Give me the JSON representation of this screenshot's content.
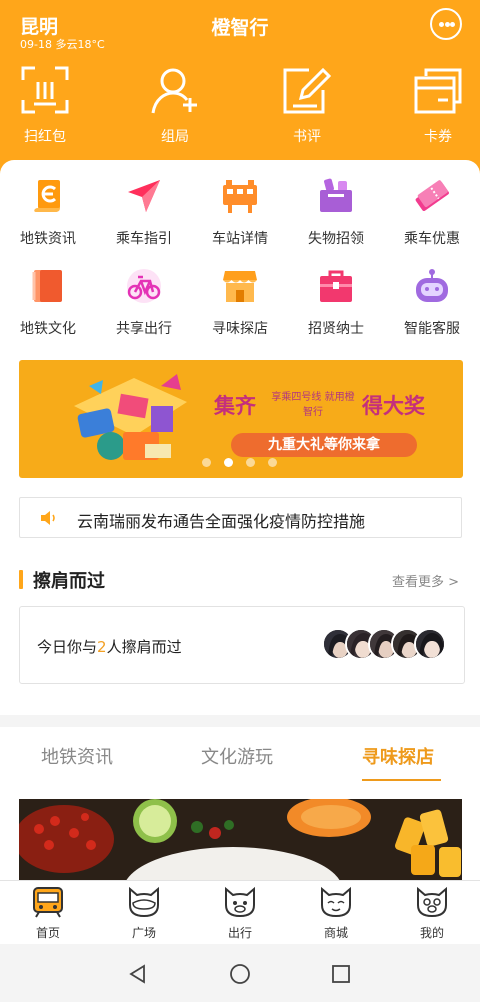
{
  "status": {
    "city": "昆明",
    "weather": "09-18 多云18°C"
  },
  "header": {
    "title": "橙智行"
  },
  "quick_actions": [
    {
      "label": "扫红包",
      "icon": "scan-icon"
    },
    {
      "label": "组局",
      "icon": "add-user-icon"
    },
    {
      "label": "书评",
      "icon": "edit-icon"
    },
    {
      "label": "卡券",
      "icon": "card-icon"
    }
  ],
  "services": [
    {
      "label": "地铁资讯",
      "icon": "metro-news-icon"
    },
    {
      "label": "乘车指引",
      "icon": "navigation-arrow-icon"
    },
    {
      "label": "车站详情",
      "icon": "station-icon"
    },
    {
      "label": "失物招领",
      "icon": "lost-found-icon"
    },
    {
      "label": "乘车优惠",
      "icon": "ticket-icon"
    },
    {
      "label": "地铁文化",
      "icon": "book-icon"
    },
    {
      "label": "共享出行",
      "icon": "bicycle-icon"
    },
    {
      "label": "寻味探店",
      "icon": "shop-icon"
    },
    {
      "label": "招贤纳士",
      "icon": "briefcase-icon"
    },
    {
      "label": "智能客服",
      "icon": "robot-icon"
    }
  ],
  "banner": {
    "word1": "集齐",
    "word2": "享乘四号线 就用橙智行",
    "word3": "得大奖",
    "slogan": "九重大礼等你来拿",
    "active_slide": 2,
    "slide_count": 4
  },
  "notice": {
    "text": "云南瑞丽发布通告全面强化疫情防控措施"
  },
  "encounter": {
    "title": "擦肩而过",
    "more": "查看更多",
    "text_before": "今日你与",
    "count": "2",
    "text_after": "人擦肩而过"
  },
  "tabs": [
    {
      "label": "地铁资讯"
    },
    {
      "label": "文化游玩"
    },
    {
      "label": "寻味探店"
    }
  ],
  "bottom_nav": [
    {
      "label": "首页",
      "icon": "train-icon"
    },
    {
      "label": "广场",
      "icon": "square-mascot-icon"
    },
    {
      "label": "出行",
      "icon": "travel-mascot-icon"
    },
    {
      "label": "商城",
      "icon": "mall-mascot-icon"
    },
    {
      "label": "我的",
      "icon": "profile-mascot-icon"
    }
  ],
  "colors": {
    "brand": "#ffa61a",
    "accent": "#ee9a1c"
  }
}
